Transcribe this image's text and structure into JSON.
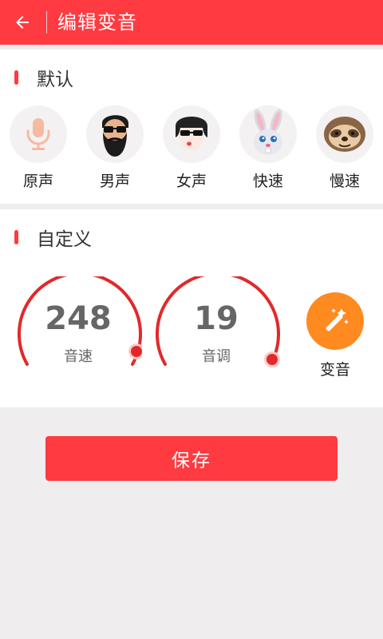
{
  "header": {
    "title": "编辑变音",
    "back_icon": "arrow-left-icon"
  },
  "default_section": {
    "title": "默认",
    "voices": [
      {
        "label": "原声",
        "icon": "microphone-icon"
      },
      {
        "label": "男声",
        "icon": "bearded-man-sunglasses-icon"
      },
      {
        "label": "女声",
        "icon": "woman-sunglasses-icon"
      },
      {
        "label": "快速",
        "icon": "rabbit-icon"
      },
      {
        "label": "慢速",
        "icon": "sloth-icon"
      }
    ]
  },
  "custom_section": {
    "title": "自定义",
    "speed": {
      "value": "248",
      "label": "音速"
    },
    "pitch": {
      "value": "19",
      "label": "音调"
    },
    "apply": {
      "label": "变音",
      "icon": "magic-wand-icon"
    }
  },
  "save_label": "保存",
  "colors": {
    "accent": "#ff3a40",
    "orange": "#ff8a1f",
    "background": "#efedee"
  }
}
